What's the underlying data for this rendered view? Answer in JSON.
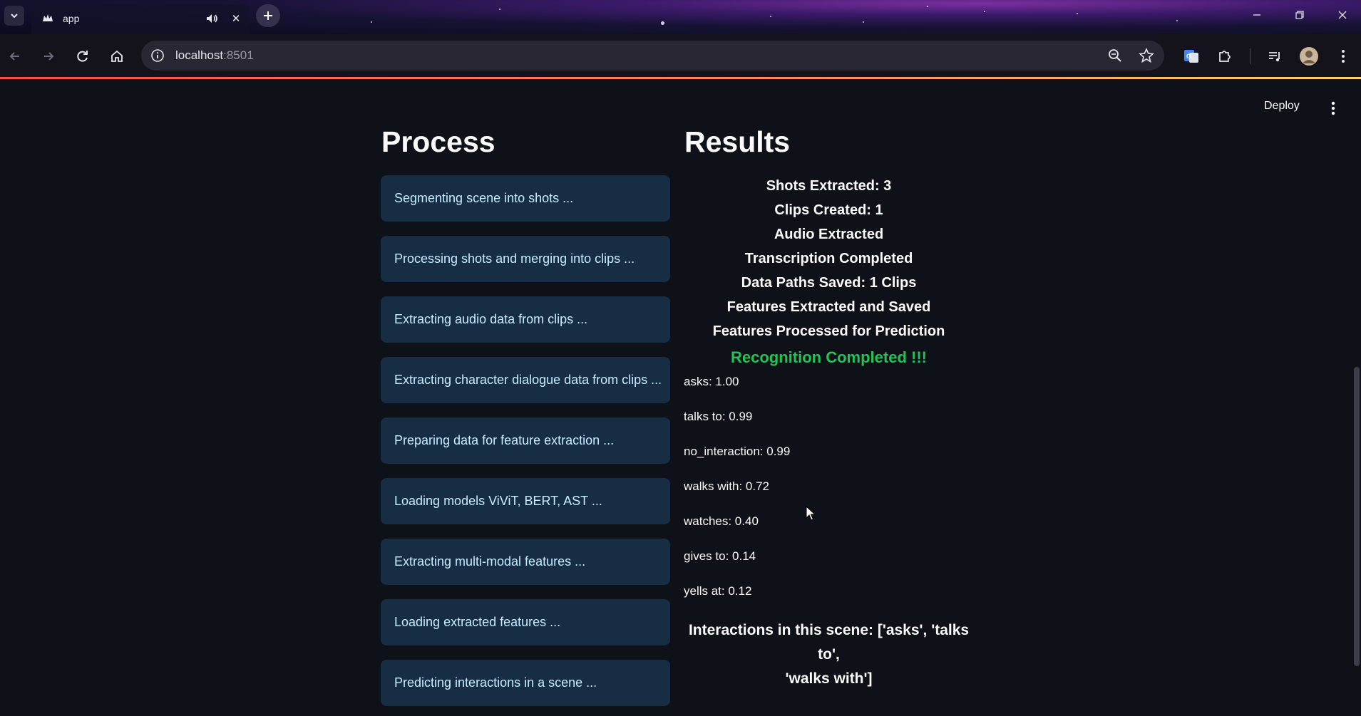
{
  "browser": {
    "tab_title": "app",
    "url_host": "localhost",
    "url_port": ":8501"
  },
  "app": {
    "deploy_label": "Deploy"
  },
  "process": {
    "title": "Process",
    "steps": [
      "Segmenting scene into shots ...",
      "Processing shots and merging into clips ...",
      "Extracting audio data from clips ...",
      "Extracting character dialogue data from clips ...",
      "Preparing data for feature extraction ...",
      "Loading models ViViT, BERT, AST ...",
      "Extracting multi-modal features ...",
      "Loading extracted features ...",
      "Predicting interactions in a scene ..."
    ]
  },
  "results": {
    "title": "Results",
    "summary": [
      "Shots Extracted: 3",
      "Clips Created: 1",
      "Audio Extracted",
      "Transcription Completed",
      "Data Paths Saved: 1 Clips",
      "Features Extracted and Saved",
      "Features Processed for Prediction"
    ],
    "completion_message": "Recognition Completed !!!",
    "completion_color": "#21c354",
    "scores": [
      "asks: 1.00",
      "talks to: 0.99",
      "no_interaction: 0.99",
      "walks with: 0.72",
      "watches: 0.40",
      "gives to: 0.14",
      "yells at: 0.12"
    ],
    "interactions_line1": "Interactions in this scene: ['asks', 'talks to',",
    "interactions_line2": "'walks with']"
  },
  "colors": {
    "background": "#0e1117",
    "step_box": "#172d43",
    "step_text": "#c7ebff"
  }
}
